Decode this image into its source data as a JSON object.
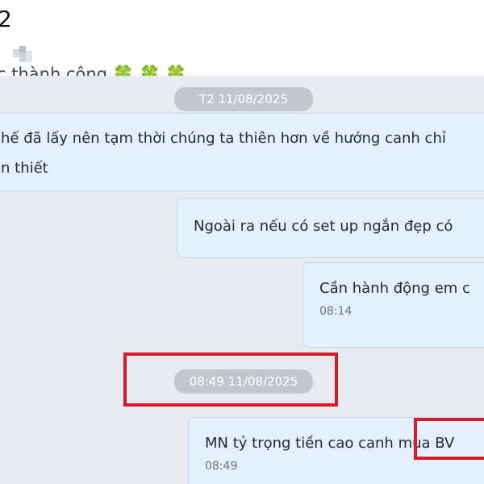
{
  "header": {
    "title": "2",
    "clipped_message": "c thành công",
    "clovers": "🍀 🍀 🍀"
  },
  "chat": {
    "date_separator_1": "T2 11/08/2025",
    "date_separator_2": "08:49 11/08/2025",
    "messages": [
      {
        "line1": "hế đã lấy nên tạm thời chúng ta thiên hơn về hướng canh chỉ",
        "line2": "n thiết"
      },
      {
        "text": "Ngoài ra nếu có set up ngắn đẹp có"
      },
      {
        "text": "Cần hành động em c",
        "time": "08:14"
      },
      {
        "text": "MN tỷ trọng tiền cao canh mua BV",
        "time": "08:49"
      }
    ]
  },
  "colors": {
    "bubble_bg": "#e4efff",
    "date_pill_bg": "#c2c7cf",
    "highlight_red": "#d9192a"
  }
}
